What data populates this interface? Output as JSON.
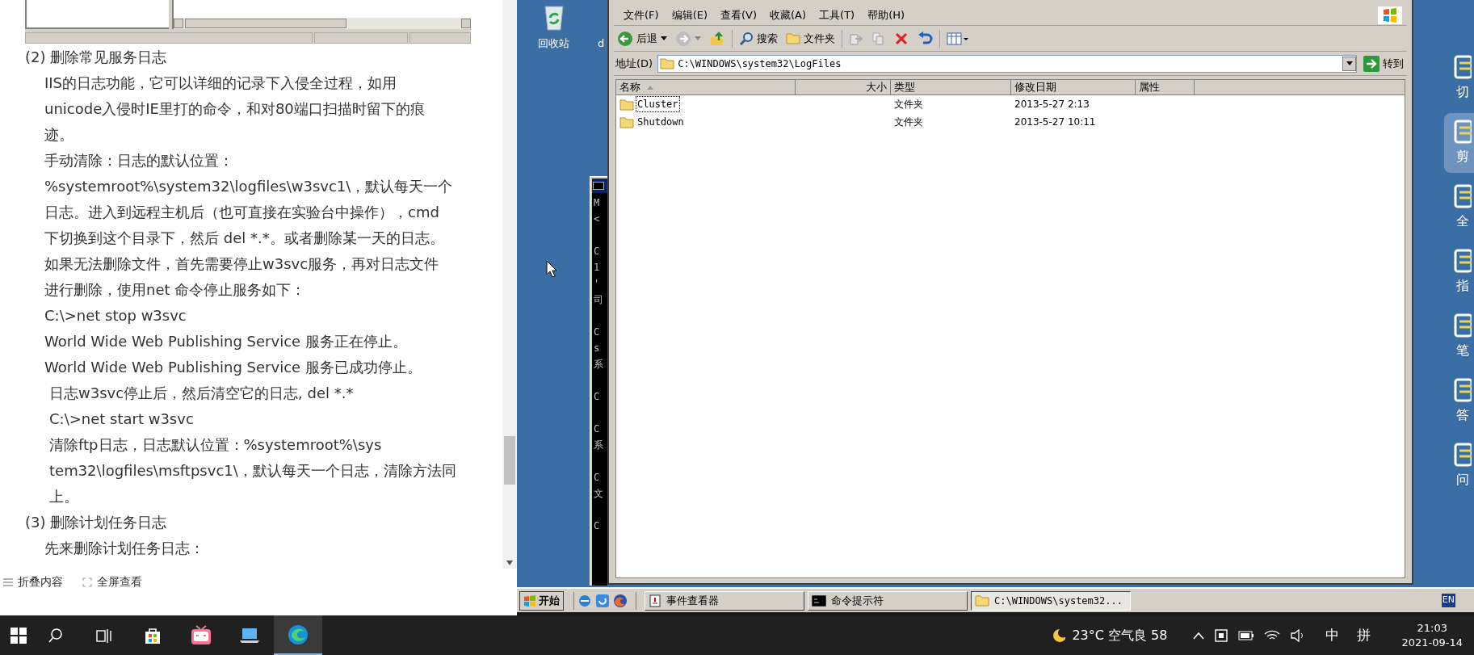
{
  "article": {
    "paragraphs": [
      {
        "kind": "heading",
        "lines": [
          "(2) 删除常见服务日志"
        ]
      },
      {
        "kind": "indent",
        "lines": [
          "IIS的日志功能，它可以详细的记录下入侵全过程，如用",
          "unicode入侵时IE里打的命令，和对80端口扫描时留下的痕",
          "迹。"
        ]
      },
      {
        "kind": "indent",
        "lines": [
          "手动清除：日志的默认位置：",
          "%systemroot%\\system32\\logfiles\\w3svc1\\，默认每天一个",
          "日志。进入到远程主机后（也可直接在实验台中操作），cmd",
          "下切换到这个目录下，然后 del *.*。或者删除某一天的日志。",
          "如果无法删除文件，首先需要停止w3svc服务，再对日志文件",
          "进行删除，使用net 命令停止服务如下："
        ]
      },
      {
        "kind": "indent",
        "lines": [
          "C:\\>net stop w3svc"
        ]
      },
      {
        "kind": "indent",
        "lines": [
          "World Wide Web Publishing Service 服务正在停止。"
        ]
      },
      {
        "kind": "indent",
        "lines": [
          "World Wide Web Publishing Service 服务已成功停止。"
        ]
      },
      {
        "kind": "deep",
        "lines": [
          "日志w3svc停止后，然后清空它的日志, del *.*"
        ]
      },
      {
        "kind": "deep",
        "lines": [
          "C:\\>net start w3svc"
        ]
      },
      {
        "kind": "deep",
        "lines": [
          "清除ftp日志，日志默认位置：%systemroot%\\sys",
          "tem32\\logfiles\\msftpsvc1\\，默认每天一个日志，清除方法同",
          "上。"
        ]
      },
      {
        "kind": "heading",
        "lines": [
          "(3) 删除计划任务日志"
        ]
      },
      {
        "kind": "indent",
        "lines": [
          "先来删除计划任务日志："
        ]
      }
    ],
    "footer": [
      {
        "kind": "collapse",
        "label": "折叠内容"
      },
      {
        "kind": "fullscreen",
        "label": "全屏查看"
      }
    ]
  },
  "remote_desktop": {
    "desktop_icons": [
      {
        "kind": "recycle",
        "label": "回收站"
      },
      {
        "kind": "cut",
        "label": "d"
      }
    ],
    "cmd_window": {
      "blocks": [
        [
          "M",
          "<"
        ],
        [
          "C",
          "1",
          "'",
          "司"
        ],
        [
          "C",
          "s",
          "系"
        ],
        [
          "C"
        ],
        [
          "C",
          "系"
        ],
        [
          "C",
          "文"
        ],
        [
          "C"
        ]
      ]
    },
    "explorer": {
      "menu": [
        "文件(F)",
        "编辑(E)",
        "查看(V)",
        "收藏(A)",
        "工具(T)",
        "帮助(H)"
      ],
      "toolbar": [
        {
          "kind": "back",
          "label": "后退"
        },
        {
          "kind": "forward"
        },
        {
          "kind": "up"
        },
        {
          "kind": "search",
          "label": "搜索"
        },
        {
          "kind": "folders",
          "label": "文件夹"
        },
        {
          "kind": "move"
        },
        {
          "kind": "copy"
        },
        {
          "kind": "delete"
        },
        {
          "kind": "undo"
        },
        {
          "kind": "views"
        }
      ],
      "address": {
        "label": "地址(D)",
        "value": "C:\\WINDOWS\\system32\\LogFiles",
        "go": "转到"
      },
      "columns": [
        {
          "label": "名称",
          "sorted": true
        },
        {
          "label": "大小",
          "sorted": false
        },
        {
          "label": "类型",
          "sorted": false
        },
        {
          "label": "修改日期",
          "sorted": false
        },
        {
          "label": "属性",
          "sorted": false
        }
      ],
      "rows": [
        {
          "name": "Cluster",
          "type": "文件夹",
          "modified": "2013-5-27 2:13",
          "focused": true
        },
        {
          "name": "Shutdown",
          "type": "文件夹",
          "modified": "2013-5-27 10:11",
          "focused": false
        }
      ]
    },
    "side_tools": [
      {
        "label": "切",
        "selected": false
      },
      {
        "label": "剪",
        "selected": true
      },
      {
        "label": "全",
        "selected": false
      },
      {
        "label": "指",
        "selected": false
      },
      {
        "label": "笔",
        "selected": false
      },
      {
        "label": "答",
        "selected": false
      },
      {
        "label": "问",
        "selected": false
      }
    ],
    "taskbar": {
      "start": "开始",
      "tasks": [
        {
          "kind": "event",
          "label": "事件查看器",
          "selected": false
        },
        {
          "kind": "cmd",
          "label": "命令提示符",
          "selected": false
        },
        {
          "kind": "folder",
          "label": "C:\\WINDOWS\\system32...",
          "selected": true
        }
      ],
      "tray": "EN"
    }
  },
  "taskbar": {
    "apps": [
      {
        "kind": "search",
        "selected": false
      },
      {
        "kind": "taskview",
        "selected": false
      },
      {
        "kind": "store",
        "selected": false
      },
      {
        "kind": "tv",
        "selected": false
      },
      {
        "kind": "laptop",
        "selected": false
      },
      {
        "kind": "edge",
        "selected": true
      }
    ],
    "weather": "23°C 空气良 58",
    "ime": [
      "中",
      "拼"
    ],
    "time": "21:03",
    "date": "2021-09-14"
  }
}
